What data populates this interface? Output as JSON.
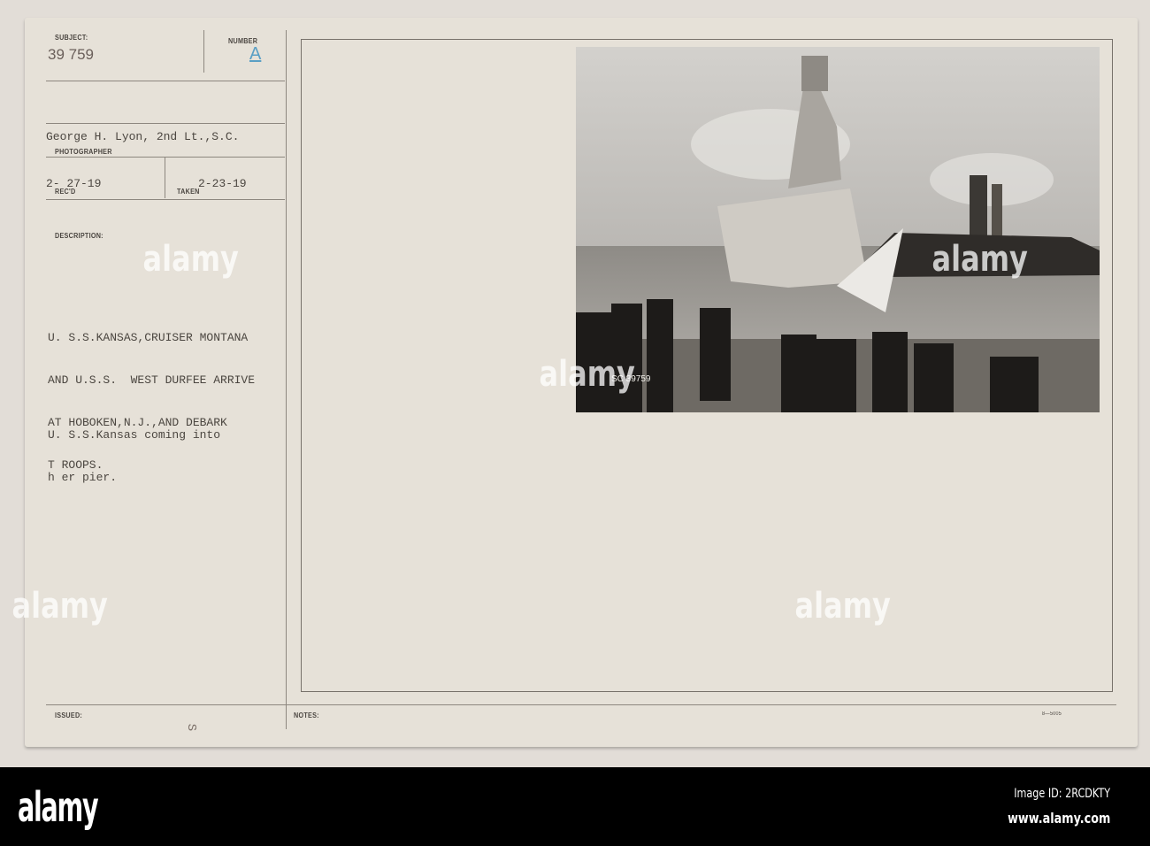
{
  "card": {
    "subject_label": "SUBJECT:",
    "subject_value": "39 759",
    "number_label": "NUMBER",
    "number_value": "A",
    "photographer_value": "George H. Lyon, 2nd Lt.,S.C.",
    "photographer_label": "PHOTOGRAPHER",
    "recd_value": "2- 27-19",
    "recd_label": "REC'D",
    "taken_value": "2-23-19",
    "taken_label": "TAKEN",
    "description_label": "DESCRIPTION:",
    "description_lines": [
      "U. S.S.KANSAS,CRUISER MONTANA",
      "AND U.S.S.  WEST DURFEE ARRIVE",
      "AT HOBOKEN,N.J.,AND DEBARK",
      "T ROOPS."
    ],
    "caption_lines": [
      "U. S.S.Kansas coming into",
      "h er pier."
    ],
    "issued_label": "ISSUED:",
    "issued_mark": "S",
    "notes_label": "NOTES:",
    "form_number": "8—5005",
    "photo_number": "SC 39759"
  },
  "watermark": {
    "text": "alamy"
  },
  "footer": {
    "logo": "alamy",
    "image_id": "Image ID: 2RCDKTY",
    "url": "www.alamy.com"
  }
}
